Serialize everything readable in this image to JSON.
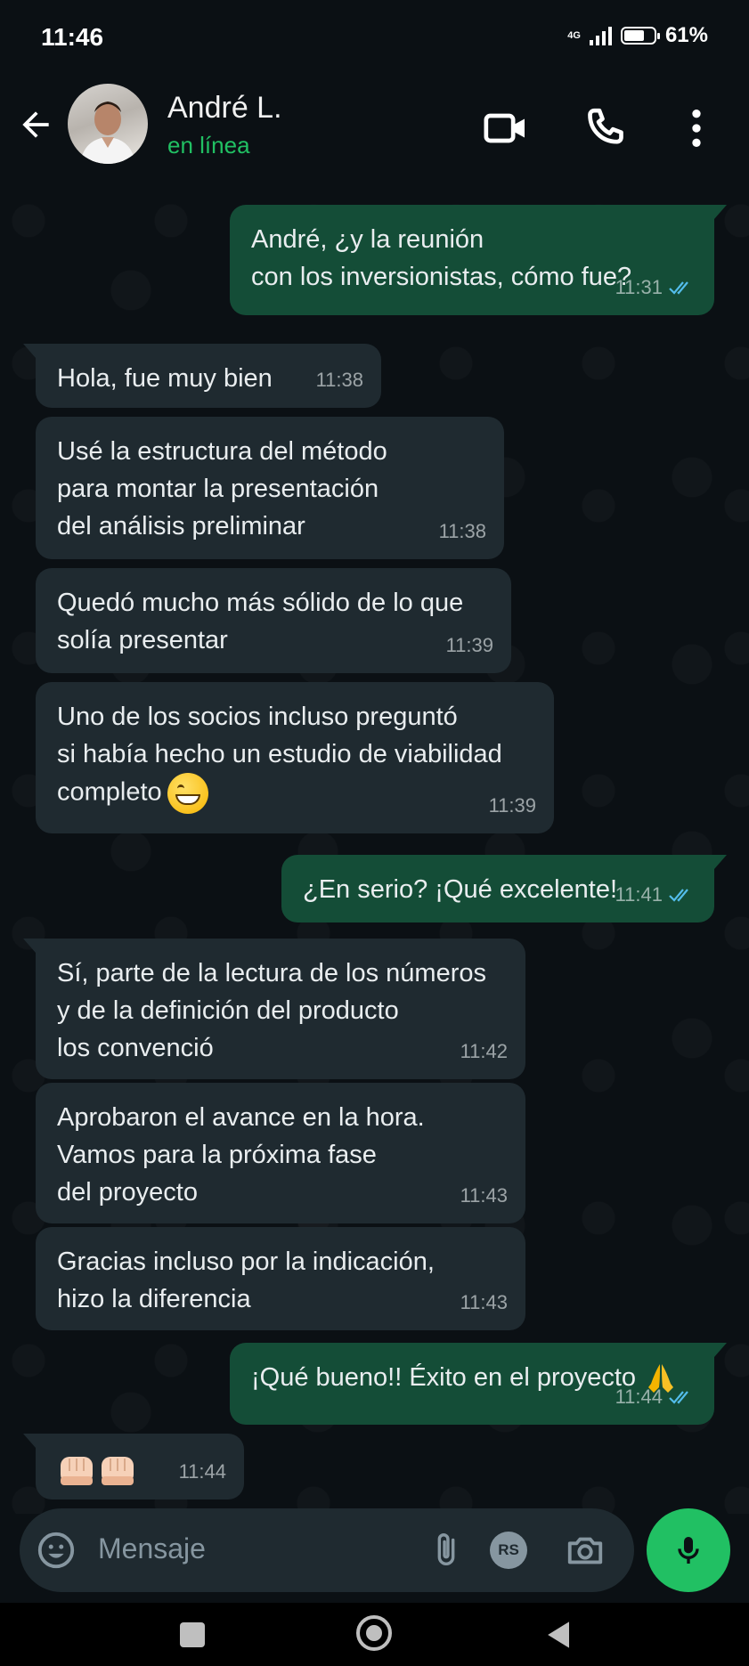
{
  "status_bar": {
    "time": "11:46",
    "network": "4G",
    "battery": "61%"
  },
  "header": {
    "contact_name": "André L.",
    "contact_status": "en línea"
  },
  "messages": [
    {
      "dir": "out",
      "text": "André, ¿y la reunión\ncon los inversionistas, cómo fue?",
      "time": "11:31",
      "status": "read"
    },
    {
      "dir": "in",
      "text": "Hola, fue muy bien",
      "time": "11:38"
    },
    {
      "dir": "in",
      "text": "Usé la estructura del método\npara montar la presentación\ndel análisis preliminar",
      "time": "11:38"
    },
    {
      "dir": "in",
      "text": "Quedó mucho más sólido de lo que\nsolía presentar",
      "time": "11:39"
    },
    {
      "dir": "in",
      "text": "Uno de los socios incluso preguntó\nsi había hecho un estudio de viabilidad\ncompleto",
      "emoji": "grinning-face",
      "time": "11:39"
    },
    {
      "dir": "out",
      "text": "¿En serio? ¡Qué excelente!",
      "time": "11:41",
      "status": "read"
    },
    {
      "dir": "in",
      "text": "Sí, parte de la lectura de los números\ny de la definición del producto\nlos convenció",
      "time": "11:42"
    },
    {
      "dir": "in",
      "text": "Aprobaron el avance en la hora.\nVamos para la próxima fase\ndel proyecto",
      "time": "11:43"
    },
    {
      "dir": "in",
      "text": "Gracias incluso por la indicación,\nhizo la diferencia",
      "time": "11:43"
    },
    {
      "dir": "out",
      "text": "¡Qué bueno!! Éxito en el proyecto",
      "emoji": "folded-hands",
      "time": "11:44",
      "status": "read"
    },
    {
      "dir": "in",
      "emoji": "fist-bump x2",
      "time": "11:44"
    }
  ],
  "composer": {
    "placeholder": "Mensaje",
    "extra_icon_label": "RS"
  },
  "colors": {
    "accent": "#21c063",
    "incoming": "#1f2a30",
    "outgoing": "#144d37",
    "read_ticks": "#53bdeb"
  }
}
